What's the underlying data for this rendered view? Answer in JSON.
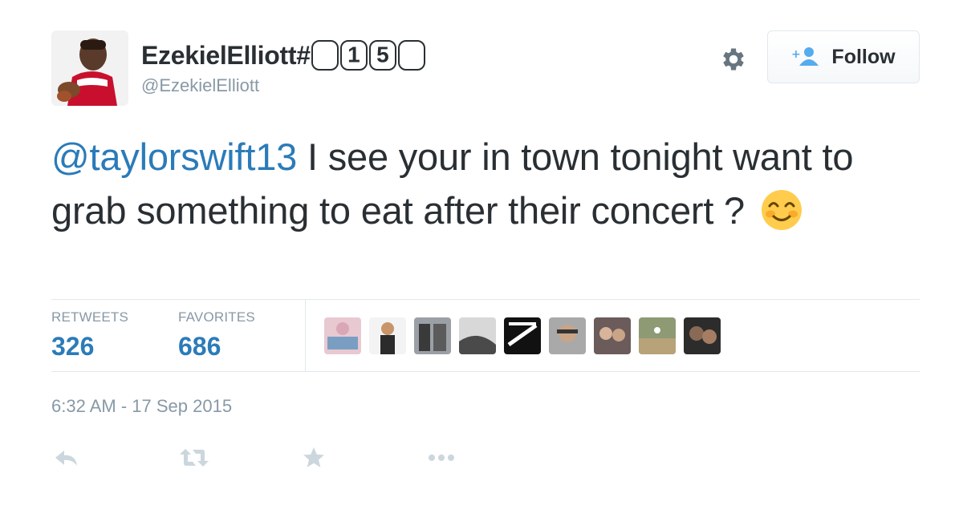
{
  "tweet": {
    "display_name_prefix": "EzekielElliott#",
    "display_name_digits": [
      "",
      "1",
      "5",
      ""
    ],
    "handle": "@EzekielElliott",
    "mention": "@taylorswift13",
    "text": " I see your in town tonight want to grab something to eat after their concert ? "
  },
  "follow_button": {
    "label": "Follow"
  },
  "stats": {
    "retweets_label": "RETWEETS",
    "retweets_value": "326",
    "favorites_label": "FAVORITES",
    "favorites_value": "686"
  },
  "timestamp": "6:32 AM - 17 Sep 2015",
  "colors": {
    "link": "#2b7bb9",
    "text": "#292f33",
    "muted": "#8899a6",
    "border": "#e1e8ed"
  },
  "icons": [
    "gear-icon",
    "add-user-icon",
    "reply-icon",
    "retweet-icon",
    "favorite-icon",
    "more-icon",
    "smiling-face-emoji"
  ]
}
